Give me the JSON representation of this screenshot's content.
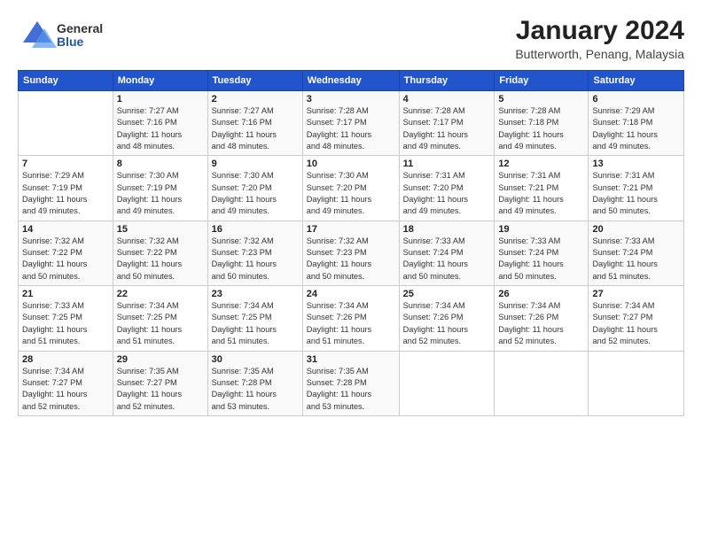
{
  "logo": {
    "general": "General",
    "blue": "Blue"
  },
  "title": "January 2024",
  "subtitle": "Butterworth, Penang, Malaysia",
  "headers": [
    "Sunday",
    "Monday",
    "Tuesday",
    "Wednesday",
    "Thursday",
    "Friday",
    "Saturday"
  ],
  "weeks": [
    [
      {
        "day": "",
        "info": ""
      },
      {
        "day": "1",
        "info": "Sunrise: 7:27 AM\nSunset: 7:16 PM\nDaylight: 11 hours\nand 48 minutes."
      },
      {
        "day": "2",
        "info": "Sunrise: 7:27 AM\nSunset: 7:16 PM\nDaylight: 11 hours\nand 48 minutes."
      },
      {
        "day": "3",
        "info": "Sunrise: 7:28 AM\nSunset: 7:17 PM\nDaylight: 11 hours\nand 48 minutes."
      },
      {
        "day": "4",
        "info": "Sunrise: 7:28 AM\nSunset: 7:17 PM\nDaylight: 11 hours\nand 49 minutes."
      },
      {
        "day": "5",
        "info": "Sunrise: 7:28 AM\nSunset: 7:18 PM\nDaylight: 11 hours\nand 49 minutes."
      },
      {
        "day": "6",
        "info": "Sunrise: 7:29 AM\nSunset: 7:18 PM\nDaylight: 11 hours\nand 49 minutes."
      }
    ],
    [
      {
        "day": "7",
        "info": "Sunrise: 7:29 AM\nSunset: 7:19 PM\nDaylight: 11 hours\nand 49 minutes."
      },
      {
        "day": "8",
        "info": "Sunrise: 7:30 AM\nSunset: 7:19 PM\nDaylight: 11 hours\nand 49 minutes."
      },
      {
        "day": "9",
        "info": "Sunrise: 7:30 AM\nSunset: 7:20 PM\nDaylight: 11 hours\nand 49 minutes."
      },
      {
        "day": "10",
        "info": "Sunrise: 7:30 AM\nSunset: 7:20 PM\nDaylight: 11 hours\nand 49 minutes."
      },
      {
        "day": "11",
        "info": "Sunrise: 7:31 AM\nSunset: 7:20 PM\nDaylight: 11 hours\nand 49 minutes."
      },
      {
        "day": "12",
        "info": "Sunrise: 7:31 AM\nSunset: 7:21 PM\nDaylight: 11 hours\nand 49 minutes."
      },
      {
        "day": "13",
        "info": "Sunrise: 7:31 AM\nSunset: 7:21 PM\nDaylight: 11 hours\nand 50 minutes."
      }
    ],
    [
      {
        "day": "14",
        "info": "Sunrise: 7:32 AM\nSunset: 7:22 PM\nDaylight: 11 hours\nand 50 minutes."
      },
      {
        "day": "15",
        "info": "Sunrise: 7:32 AM\nSunset: 7:22 PM\nDaylight: 11 hours\nand 50 minutes."
      },
      {
        "day": "16",
        "info": "Sunrise: 7:32 AM\nSunset: 7:23 PM\nDaylight: 11 hours\nand 50 minutes."
      },
      {
        "day": "17",
        "info": "Sunrise: 7:32 AM\nSunset: 7:23 PM\nDaylight: 11 hours\nand 50 minutes."
      },
      {
        "day": "18",
        "info": "Sunrise: 7:33 AM\nSunset: 7:24 PM\nDaylight: 11 hours\nand 50 minutes."
      },
      {
        "day": "19",
        "info": "Sunrise: 7:33 AM\nSunset: 7:24 PM\nDaylight: 11 hours\nand 50 minutes."
      },
      {
        "day": "20",
        "info": "Sunrise: 7:33 AM\nSunset: 7:24 PM\nDaylight: 11 hours\nand 51 minutes."
      }
    ],
    [
      {
        "day": "21",
        "info": "Sunrise: 7:33 AM\nSunset: 7:25 PM\nDaylight: 11 hours\nand 51 minutes."
      },
      {
        "day": "22",
        "info": "Sunrise: 7:34 AM\nSunset: 7:25 PM\nDaylight: 11 hours\nand 51 minutes."
      },
      {
        "day": "23",
        "info": "Sunrise: 7:34 AM\nSunset: 7:25 PM\nDaylight: 11 hours\nand 51 minutes."
      },
      {
        "day": "24",
        "info": "Sunrise: 7:34 AM\nSunset: 7:26 PM\nDaylight: 11 hours\nand 51 minutes."
      },
      {
        "day": "25",
        "info": "Sunrise: 7:34 AM\nSunset: 7:26 PM\nDaylight: 11 hours\nand 52 minutes."
      },
      {
        "day": "26",
        "info": "Sunrise: 7:34 AM\nSunset: 7:26 PM\nDaylight: 11 hours\nand 52 minutes."
      },
      {
        "day": "27",
        "info": "Sunrise: 7:34 AM\nSunset: 7:27 PM\nDaylight: 11 hours\nand 52 minutes."
      }
    ],
    [
      {
        "day": "28",
        "info": "Sunrise: 7:34 AM\nSunset: 7:27 PM\nDaylight: 11 hours\nand 52 minutes."
      },
      {
        "day": "29",
        "info": "Sunrise: 7:35 AM\nSunset: 7:27 PM\nDaylight: 11 hours\nand 52 minutes."
      },
      {
        "day": "30",
        "info": "Sunrise: 7:35 AM\nSunset: 7:28 PM\nDaylight: 11 hours\nand 53 minutes."
      },
      {
        "day": "31",
        "info": "Sunrise: 7:35 AM\nSunset: 7:28 PM\nDaylight: 11 hours\nand 53 minutes."
      },
      {
        "day": "",
        "info": ""
      },
      {
        "day": "",
        "info": ""
      },
      {
        "day": "",
        "info": ""
      }
    ]
  ]
}
